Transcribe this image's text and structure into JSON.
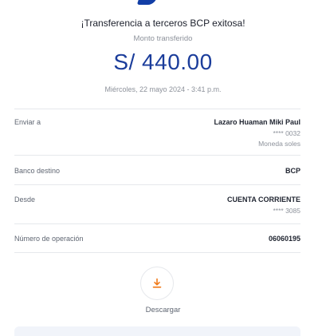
{
  "receipt": {
    "title": "¡Transferencia a terceros BCP exitosa!",
    "amount_label": "Monto transferido",
    "amount": "S/ 440.00",
    "datetime": "Miércoles, 22 mayo 2024 - 3:41 p.m."
  },
  "details": {
    "send_to": {
      "label": "Enviar a",
      "name": "Lazaro Huaman Miki Paul",
      "account": "**** 0032",
      "currency": "Moneda soles"
    },
    "bank": {
      "label": "Banco destino",
      "value": "BCP"
    },
    "from": {
      "label": "Desde",
      "value": "CUENTA CORRIENTE",
      "account": "**** 3085"
    },
    "operation": {
      "label": "Número de operación",
      "value": "06060195"
    }
  },
  "actions": {
    "download_label": "Descargar",
    "download_icon": "download-icon"
  },
  "colors": {
    "brand_blue": "#1b3d9b",
    "accent_orange": "#f07a1a"
  }
}
